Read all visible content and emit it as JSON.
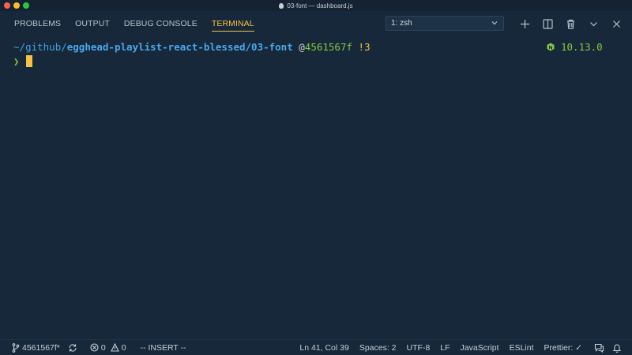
{
  "window": {
    "title": "03-font — dashboard.js"
  },
  "panel": {
    "tabs": [
      {
        "label": "PROBLEMS",
        "active": false
      },
      {
        "label": "OUTPUT",
        "active": false
      },
      {
        "label": "DEBUG CONSOLE",
        "active": false
      },
      {
        "label": "TERMINAL",
        "active": true
      }
    ],
    "terminal_select": "1: zsh",
    "icons": [
      "plus-icon",
      "split-icon",
      "trash-icon",
      "chevron-down-icon",
      "close-icon"
    ]
  },
  "terminal": {
    "prompt": {
      "tilde": "~/",
      "dir_dim": "github/",
      "path": "egghead-playlist-react-blessed/03-font",
      "at": "@",
      "commit": "4561567f",
      "dirty": "!3"
    },
    "node_version": "10.13.0",
    "input_prompt": "❯"
  },
  "statusbar": {
    "branch": "4561567f*",
    "errors": "0",
    "warnings": "0",
    "mode": "-- INSERT --",
    "position": "Ln 41, Col 39",
    "spaces": "Spaces: 2",
    "encoding": "UTF-8",
    "eol": "LF",
    "language": "JavaScript",
    "eslint": "ESLint",
    "prettier": "Prettier: ✓"
  },
  "colors": {
    "background": "#17283a",
    "accent": "#f5c244",
    "green": "#87c93f",
    "blue": "#49a8ea"
  }
}
